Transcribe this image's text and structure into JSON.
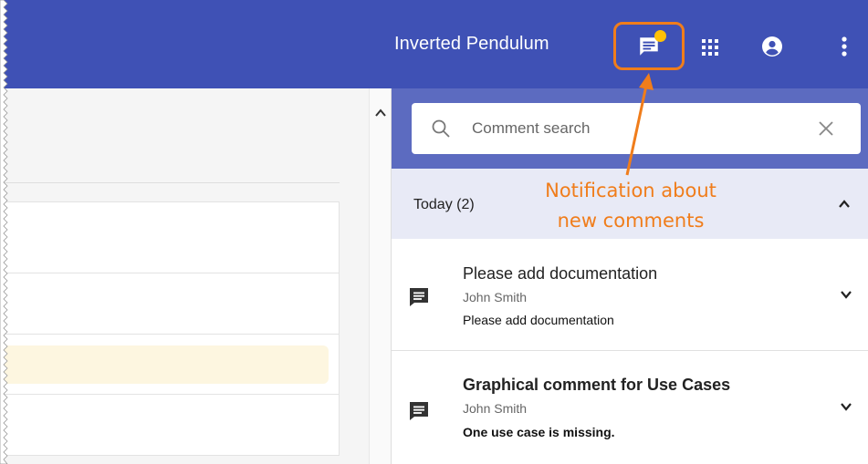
{
  "header": {
    "title": "Inverted Pendulum"
  },
  "comments_panel": {
    "search": {
      "placeholder": "Comment search",
      "value": ""
    },
    "groups": [
      {
        "label": "Today (2)",
        "expanded": true,
        "items": [
          {
            "title": "Please add documentation",
            "author": "John Smith",
            "text": "Please add documentation",
            "unread": false
          },
          {
            "title": "Graphical comment for Use Cases",
            "author": "John Smith",
            "text": "One use case is missing.",
            "unread": true
          }
        ]
      }
    ]
  },
  "annotation": {
    "line1": "Notification about",
    "line2": "new comments"
  },
  "icons": {
    "comments": "comment-icon",
    "notification": "notification-dot",
    "apps": "apps-grid-icon",
    "account": "account-circle-icon",
    "more": "more-vert-icon",
    "search": "search-icon",
    "clear": "close-icon",
    "collapse": "chevron-up-icon",
    "expand": "chevron-down-icon"
  },
  "colors": {
    "app_bar": "#3f51b5",
    "panel_search_bar": "#5c6bc0",
    "group_header": "#e8eaf6",
    "notification_dot": "#ffc107",
    "annotation": "#f07d1b"
  }
}
